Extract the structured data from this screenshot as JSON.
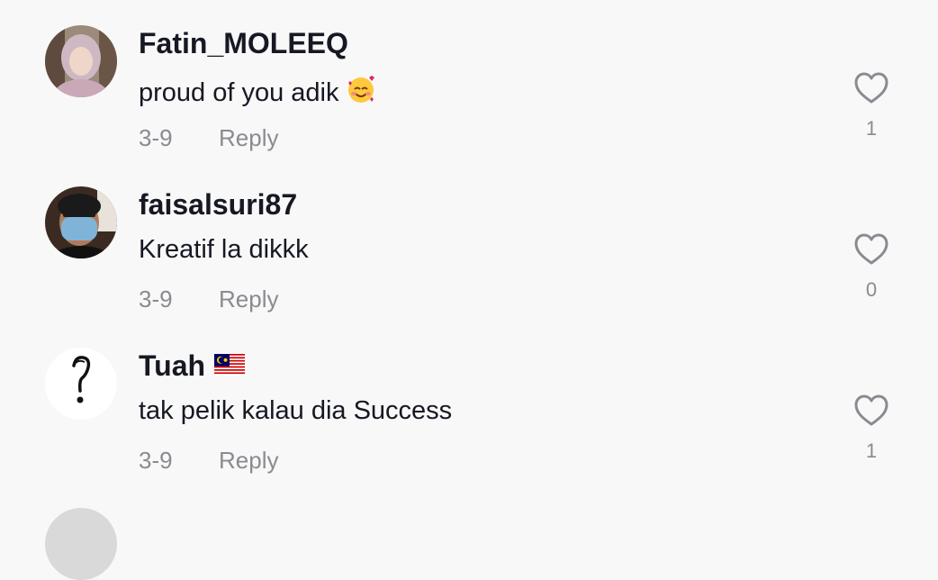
{
  "comments": [
    {
      "username": "Fatin_MOLEEQ",
      "text": "proud of you adik",
      "emoji": "smiling-face-with-hearts-icon",
      "date": "3-9",
      "reply_label": "Reply",
      "likes": "1"
    },
    {
      "username": "faisalsuri87",
      "text": "Kreatif la dikkk",
      "date": "3-9",
      "reply_label": "Reply",
      "likes": "0"
    },
    {
      "username": "Tuah",
      "flag": "malaysia-flag-icon",
      "text": "tak pelik kalau dia Success",
      "date": "3-9",
      "reply_label": "Reply",
      "likes": "1"
    }
  ],
  "colors": {
    "text": "#161823",
    "secondary": "#8a8b91",
    "background": "#f8f8f8"
  },
  "icons": {
    "like": "heart-outline-icon"
  }
}
